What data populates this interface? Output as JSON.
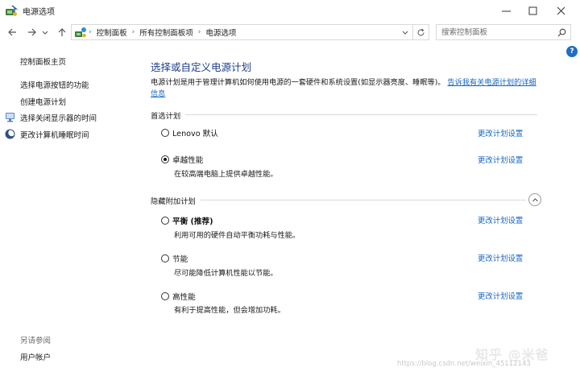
{
  "window": {
    "title": "电源选项",
    "minimize_icon": "minimize-icon",
    "maximize_icon": "maximize-icon",
    "close_icon": "close-icon"
  },
  "nav": {
    "breadcrumbs": [
      "控制面板",
      "所有控制面板项",
      "电源选项"
    ],
    "search_placeholder": "搜索控制面板"
  },
  "sidebar": {
    "home": "控制面板主页",
    "links": [
      {
        "label": "选择电源按钮的功能"
      },
      {
        "label": "创建电源计划"
      },
      {
        "label": "选择关闭显示器的时间",
        "icon": "monitor-icon"
      },
      {
        "label": "更改计算机睡眠时间",
        "icon": "moon-icon"
      }
    ],
    "see_also_label": "另请参阅",
    "see_also_links": [
      "用户帐户"
    ]
  },
  "main": {
    "title": "选择或自定义电源计划",
    "description": "电源计划是用于管理计算机如何使用电源的一套硬件和系统设置(如显示器亮度、睡眠等)。",
    "description_link": "告诉我有关电源计划的详细信息",
    "preferred_label": "首选计划",
    "hidden_label": "隐藏附加计划",
    "change_label": "更改计划设置",
    "preferred_plans": [
      {
        "name": "Lenovo 默认",
        "desc": "",
        "selected": false,
        "bold": false
      },
      {
        "name": "卓越性能",
        "desc": "在较高端电脑上提供卓越性能。",
        "selected": true,
        "bold": false
      }
    ],
    "hidden_plans": [
      {
        "name": "平衡 (推荐)",
        "desc": "利用可用的硬件自动平衡功耗与性能。",
        "selected": false,
        "bold": true
      },
      {
        "name": "节能",
        "desc": "尽可能降低计算机性能以节能。",
        "selected": false,
        "bold": false
      },
      {
        "name": "高性能",
        "desc": "有利于提高性能，但会增加功耗。",
        "selected": false,
        "bold": false
      }
    ]
  },
  "watermark": {
    "text": "知乎 @米爸",
    "url": "https://blog.csdn.net/weixin_45112143"
  }
}
